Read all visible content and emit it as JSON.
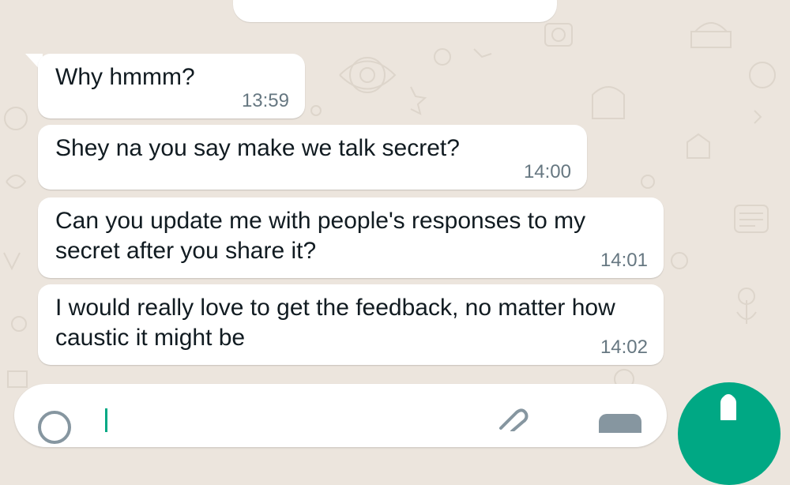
{
  "colors": {
    "wallpaper": "#ece5dd",
    "bubble": "#ffffff",
    "text": "#111b21",
    "timestamp": "#667781",
    "accent": "#00a884"
  },
  "messages": [
    {
      "text": "Why hmmm?",
      "time": "13:59"
    },
    {
      "text": "Shey na you say make we talk secret?",
      "time": "14:00"
    },
    {
      "text": "Can you update me with people's responses to my secret after you share it?",
      "time": "14:01"
    },
    {
      "text": "I would really love to get the feedback, no matter how caustic it might be",
      "time": "14:02"
    }
  ],
  "composer": {
    "message": "",
    "icons": [
      "emoji-icon",
      "attach-icon",
      "camera-icon"
    ]
  },
  "send": {
    "icon": "mic-icon"
  }
}
